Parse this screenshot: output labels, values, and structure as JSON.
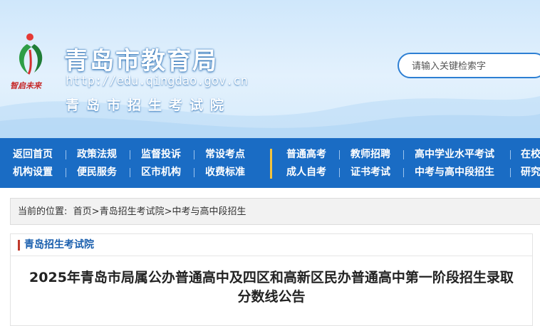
{
  "header": {
    "site_title": "青岛市教育局",
    "site_url": "http://edu.qingdao.gov.cn",
    "site_subtitle": "青岛市招生考试院",
    "logo_icon": "qingdao-education-bureau-logo",
    "logo_motto": "智启未来",
    "search_placeholder": "请输入关键检索字"
  },
  "nav": {
    "row1": [
      "返回首页",
      "政策法规",
      "监督投诉",
      "常设考点",
      "普通高考",
      "教师招聘",
      "高中学业水平考试",
      "在校"
    ],
    "row2": [
      "机构设置",
      "便民服务",
      "区市机构",
      "收费标准",
      "成人自考",
      "证书考试",
      "中考与高中段招生",
      "研究"
    ]
  },
  "breadcrumb": {
    "prefix": "当前的位置:",
    "items": [
      "首页",
      "青岛招生考试院",
      "中考与高中段招生"
    ],
    "separator": ">"
  },
  "content": {
    "section_label": "青岛招生考试院",
    "article_title_line1": "2025年青岛市局属公办普通高中及四区和高新区民办普通高中第一阶段招生录取",
    "article_title_line2": "分数线公告"
  },
  "colors": {
    "nav_bg": "#1a6cc4",
    "accent_divider": "#f3c33c",
    "section_bar": "#c0392b",
    "section_label": "#1a5fae"
  }
}
